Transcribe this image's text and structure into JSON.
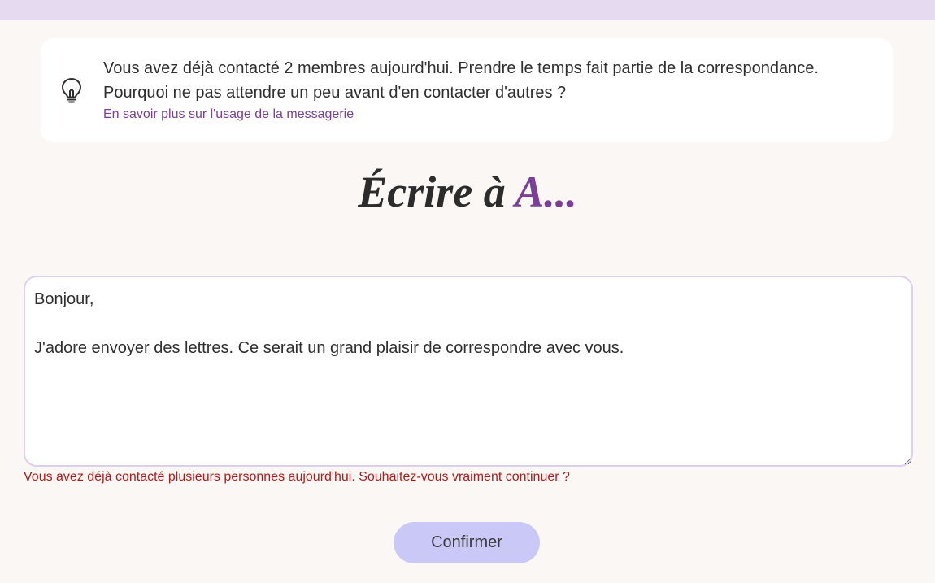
{
  "tip": {
    "icon": "lightbulb-icon",
    "message": "Vous avez déjà contacté 2 membres aujourd'hui. Prendre le temps fait partie de la correspondance. Pourquoi ne pas attendre un peu avant d'en contacter d'autres ?",
    "link_label": "En savoir plus sur l'usage de la messagerie"
  },
  "compose": {
    "title_prefix": "Écrire à ",
    "recipient": "A...",
    "message_value": "Bonjour,\n\nJ'adore envoyer des lettres. Ce serait un grand plaisir de correspondre avec vous.",
    "warning": "Vous avez déjà contacté plusieurs personnes aujourd'hui. Souhaitez-vous vraiment continuer ?",
    "confirm_label": "Confirmer"
  },
  "colors": {
    "top_bar": "#e6daf1",
    "accent": "#7b3f98",
    "warning": "#b31b1b",
    "button": "#c9c8f7",
    "background": "#fbf7f5"
  }
}
